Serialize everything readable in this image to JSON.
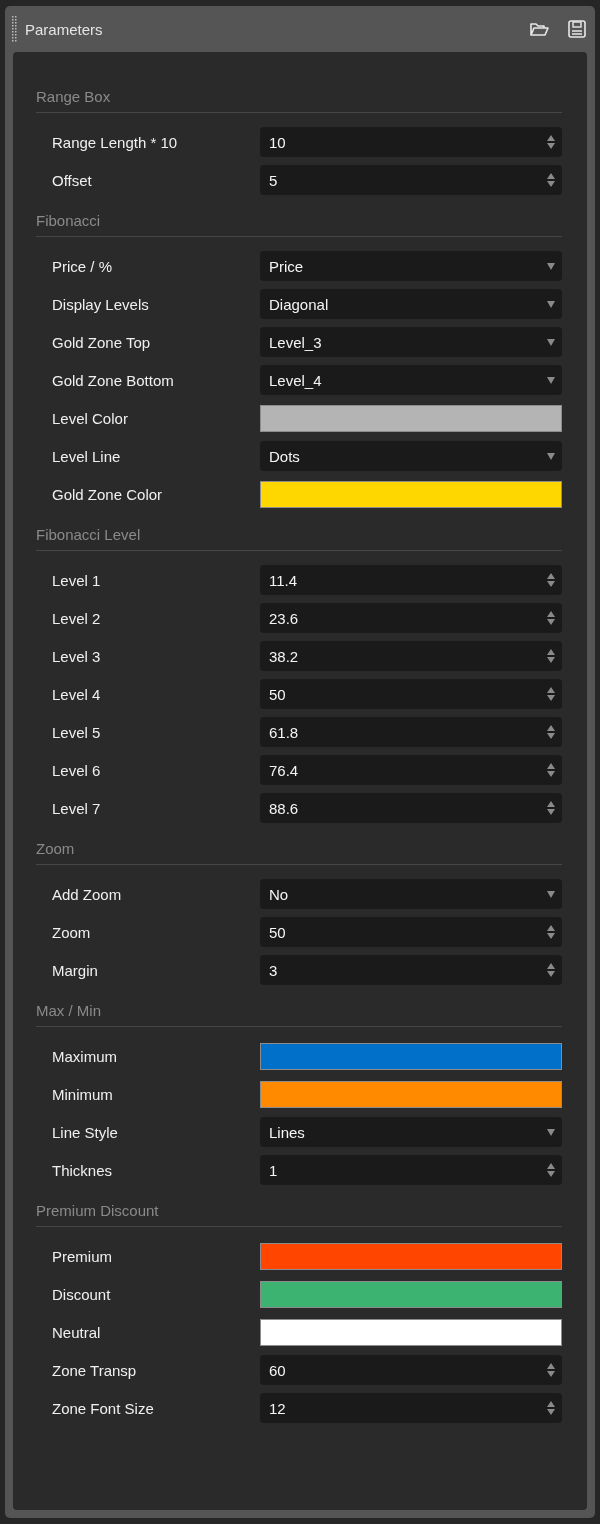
{
  "window": {
    "title": "Parameters"
  },
  "sections": [
    {
      "title": "Range Box",
      "rows": [
        {
          "label": "Range Length * 10",
          "kind": "spin",
          "value": "10"
        },
        {
          "label": "Offset",
          "kind": "spin",
          "value": "5"
        }
      ]
    },
    {
      "title": "Fibonacci",
      "rows": [
        {
          "label": "Price / %",
          "kind": "select",
          "value": "Price"
        },
        {
          "label": "Display Levels",
          "kind": "select",
          "value": "Diagonal"
        },
        {
          "label": "Gold Zone Top",
          "kind": "select",
          "value": "Level_3"
        },
        {
          "label": "Gold Zone Bottom",
          "kind": "select",
          "value": "Level_4"
        },
        {
          "label": "Level Color",
          "kind": "color",
          "color": "#b4b4b4"
        },
        {
          "label": "Level Line",
          "kind": "select",
          "value": "Dots"
        },
        {
          "label": "Gold Zone Color",
          "kind": "color",
          "color": "#ffd700"
        }
      ]
    },
    {
      "title": "Fibonacci Level",
      "rows": [
        {
          "label": "Level 1",
          "kind": "spin",
          "value": "11.4"
        },
        {
          "label": "Level 2",
          "kind": "spin",
          "value": "23.6"
        },
        {
          "label": "Level 3",
          "kind": "spin",
          "value": "38.2"
        },
        {
          "label": "Level 4",
          "kind": "spin",
          "value": "50"
        },
        {
          "label": "Level 5",
          "kind": "spin",
          "value": "61.8"
        },
        {
          "label": "Level 6",
          "kind": "spin",
          "value": "76.4"
        },
        {
          "label": "Level 7",
          "kind": "spin",
          "value": "88.6"
        }
      ]
    },
    {
      "title": "Zoom",
      "rows": [
        {
          "label": "Add Zoom",
          "kind": "select",
          "value": "No"
        },
        {
          "label": "Zoom",
          "kind": "spin",
          "value": "50"
        },
        {
          "label": "Margin",
          "kind": "spin",
          "value": "3"
        }
      ]
    },
    {
      "title": "Max / Min",
      "rows": [
        {
          "label": "Maximum",
          "kind": "color",
          "color": "#0070c8"
        },
        {
          "label": "Minimum",
          "kind": "color",
          "color": "#ff8a00"
        },
        {
          "label": "Line Style",
          "kind": "select",
          "value": "Lines"
        },
        {
          "label": "Thicknes",
          "kind": "spin",
          "value": "1"
        }
      ]
    },
    {
      "title": "Premium Discount",
      "rows": [
        {
          "label": "Premium",
          "kind": "color",
          "color": "#ff4500"
        },
        {
          "label": "Discount",
          "kind": "color",
          "color": "#3cb371"
        },
        {
          "label": "Neutral",
          "kind": "color",
          "color": "#ffffff"
        },
        {
          "label": "Zone Transp",
          "kind": "spin",
          "value": "60"
        },
        {
          "label": "Zone Font Size",
          "kind": "spin",
          "value": "12"
        }
      ]
    }
  ]
}
